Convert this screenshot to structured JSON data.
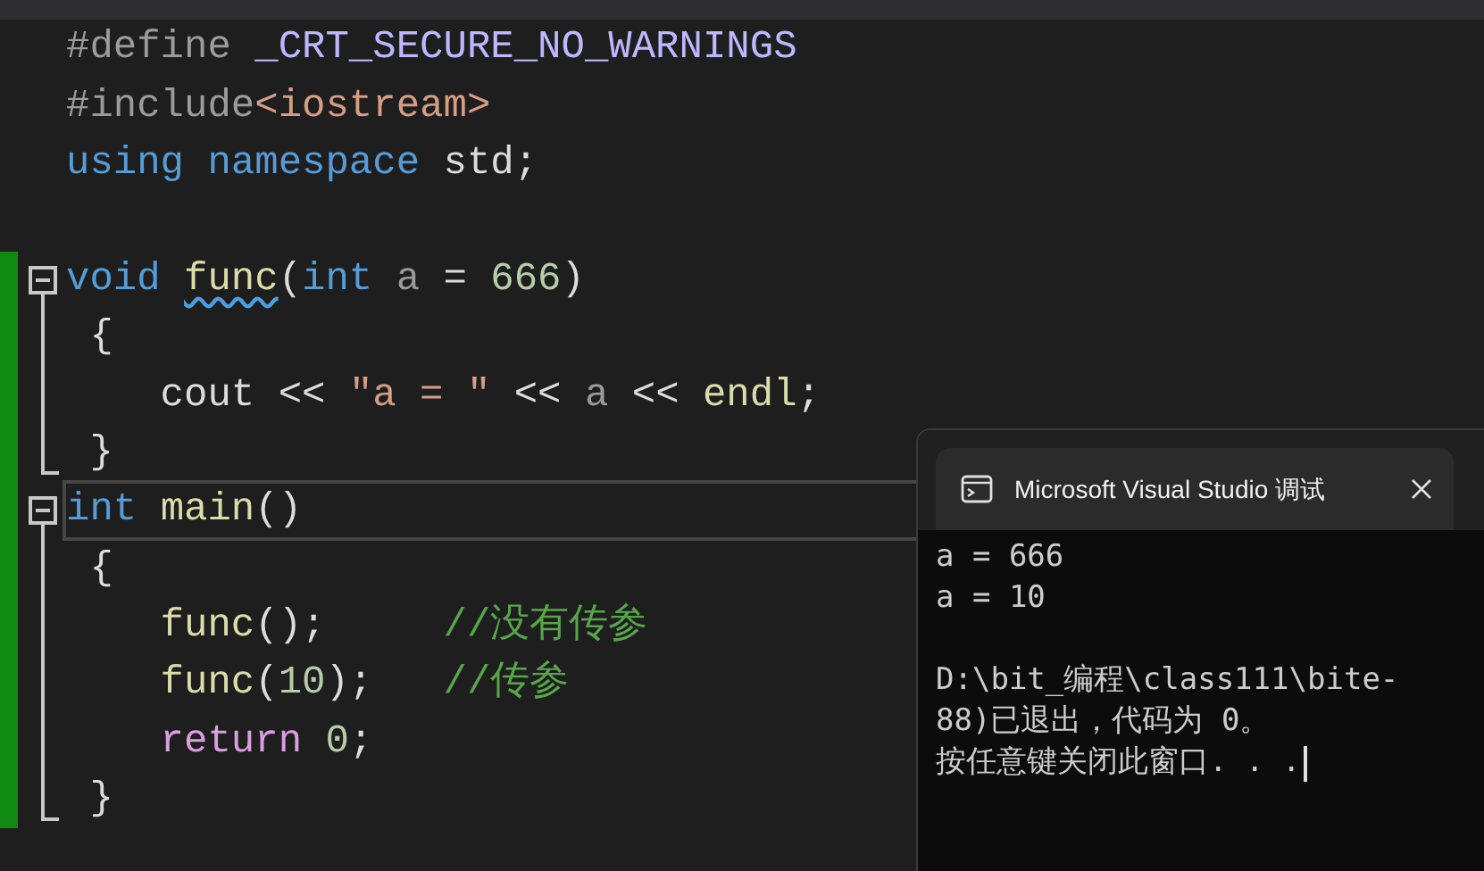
{
  "editor": {
    "lines": [
      {
        "tokens": [
          {
            "text": "#define ",
            "kind": "preprocessor"
          },
          {
            "text": "_CRT_SECURE_NO_WARNINGS",
            "kind": "macro"
          }
        ]
      },
      {
        "tokens": [
          {
            "text": "#include",
            "kind": "preprocessor"
          },
          {
            "text": "<iostream>",
            "kind": "string"
          }
        ]
      },
      {
        "tokens": [
          {
            "text": "using ",
            "kind": "keyword"
          },
          {
            "text": "namespace",
            "kind": "keyword"
          },
          {
            "text": " std;",
            "kind": "plain"
          }
        ]
      },
      {
        "kind": "blank"
      },
      {
        "tokens": [
          {
            "text": "void ",
            "kind": "keyword"
          },
          {
            "text": "func",
            "kind": "function",
            "squiggle": true
          },
          {
            "text": "(",
            "kind": "plain"
          },
          {
            "text": "int",
            "kind": "keyword"
          },
          {
            "text": " a ",
            "kind": "param"
          },
          {
            "text": "= ",
            "kind": "plain"
          },
          {
            "text": "666",
            "kind": "number"
          },
          {
            "text": ")",
            "kind": "plain"
          }
        ],
        "changed": true,
        "kind": "fold_start",
        "expanded": true
      },
      {
        "tokens": [
          {
            "text": " {",
            "kind": "plain"
          }
        ],
        "changed": true,
        "kind": "fold_body"
      },
      {
        "tokens": [
          {
            "text": "    cout << ",
            "kind": "plain"
          },
          {
            "text": "\"a = \"",
            "kind": "string"
          },
          {
            "text": " << ",
            "kind": "plain"
          },
          {
            "text": "a",
            "kind": "param"
          },
          {
            "text": " << ",
            "kind": "plain"
          },
          {
            "text": "endl",
            "kind": "function"
          },
          {
            "text": ";",
            "kind": "plain"
          }
        ],
        "changed": true,
        "kind": "fold_body"
      },
      {
        "tokens": [
          {
            "text": " }",
            "kind": "plain"
          }
        ],
        "changed": true,
        "kind": "fold_end"
      },
      {
        "tokens": [
          {
            "text": "int ",
            "kind": "keyword"
          },
          {
            "text": "main",
            "kind": "function"
          },
          {
            "text": "()",
            "kind": "plain"
          }
        ],
        "changed": true,
        "kind": "fold_start",
        "expanded": true,
        "current": true
      },
      {
        "tokens": [
          {
            "text": " {",
            "kind": "plain"
          }
        ],
        "changed": true,
        "kind": "fold_body"
      },
      {
        "tokens": [
          {
            "text": "    func",
            "kind": "function"
          },
          {
            "text": "();     ",
            "kind": "plain"
          },
          {
            "text": "//没有传参",
            "kind": "comment"
          }
        ],
        "changed": true,
        "kind": "fold_body"
      },
      {
        "tokens": [
          {
            "text": "    func",
            "kind": "function"
          },
          {
            "text": "(",
            "kind": "plain"
          },
          {
            "text": "10",
            "kind": "number"
          },
          {
            "text": ");   ",
            "kind": "plain"
          },
          {
            "text": "//传参",
            "kind": "comment"
          }
        ],
        "changed": true,
        "kind": "fold_body"
      },
      {
        "tokens": [
          {
            "text": "    return ",
            "kind": "control"
          },
          {
            "text": "0",
            "kind": "number"
          },
          {
            "text": ";",
            "kind": "plain"
          }
        ],
        "changed": true,
        "kind": "fold_body"
      },
      {
        "tokens": [
          {
            "text": " }",
            "kind": "plain"
          }
        ],
        "changed": true,
        "kind": "fold_end"
      }
    ]
  },
  "console": {
    "title": "Microsoft Visual Studio 调试",
    "output": [
      "a = 666",
      "a = 10"
    ],
    "exit_message": [
      "D:\\bit_编程\\class111\\bite-",
      "88)已退出，代码为 0。",
      "按任意键关闭此窗口. . ."
    ]
  }
}
